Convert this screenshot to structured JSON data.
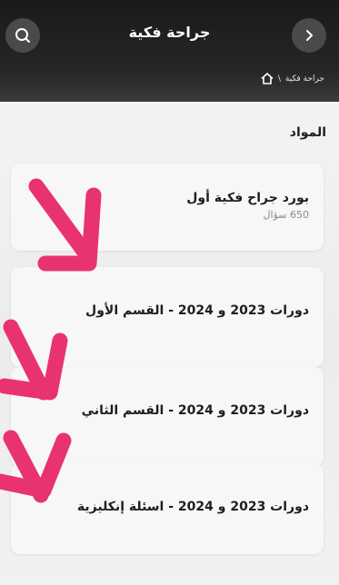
{
  "header": {
    "title": "جراحة فكية",
    "back_icon": "chevron-right-icon",
    "search_icon": "search-icon"
  },
  "breadcrumb": {
    "home_icon": "home-icon",
    "separator": "\\",
    "current": "جراحة فكية"
  },
  "section": {
    "label": "المواد"
  },
  "items": [
    {
      "title": "بورد جراح فكية أول",
      "subtitle": "650 سؤال"
    },
    {
      "title": "دورات 2023 و 2024 - القسم الأول"
    },
    {
      "title": "دورات 2023 و 2024 - القسم الثاني"
    },
    {
      "title": "دورات 2023 و 2024 - اسئلة إنكليزية"
    }
  ],
  "colors": {
    "header_bg": "#262626",
    "annotation_arrow": "#e8336f"
  }
}
